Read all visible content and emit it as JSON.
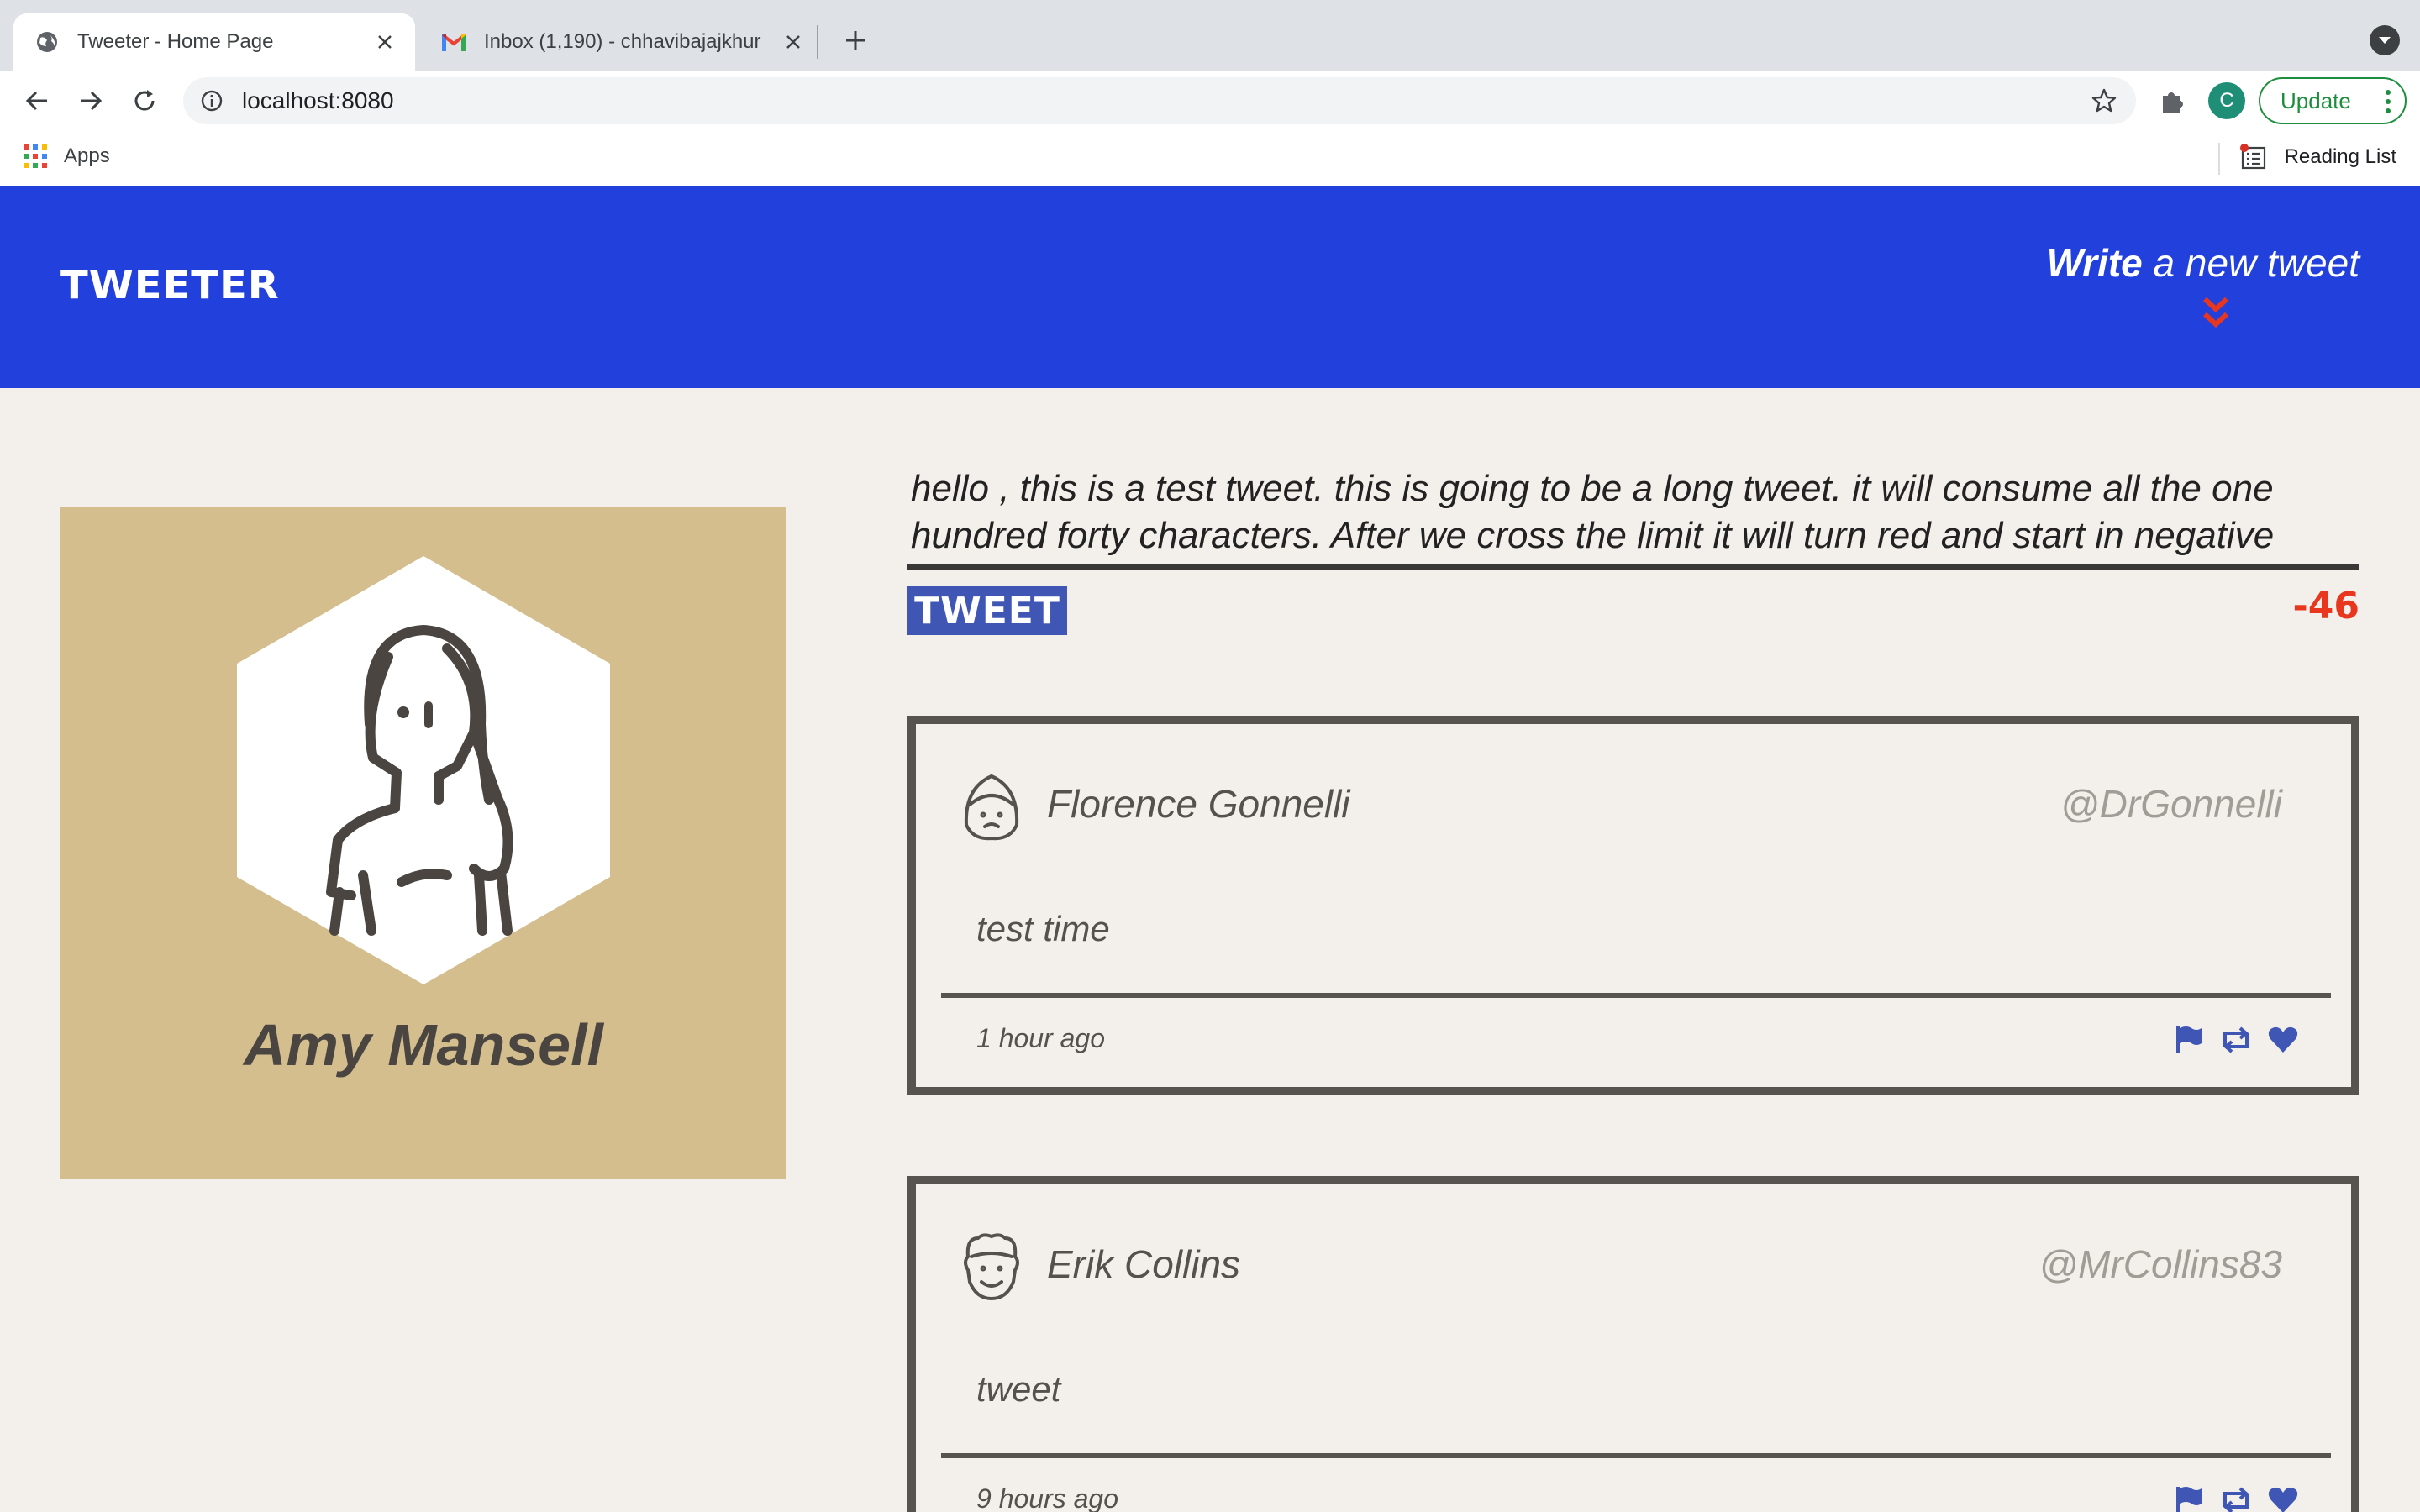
{
  "browser": {
    "tabs": [
      {
        "title": "Tweeter - Home Page",
        "active": true
      },
      {
        "title": "Inbox (1,190) - chhavibajajkhur",
        "active": false
      }
    ],
    "url": "localhost:8080",
    "profile_initial": "C",
    "update_label": "Update",
    "bookmarks": {
      "apps_label": "Apps",
      "reading_list_label": "Reading List"
    }
  },
  "header": {
    "logo": "TWEETER",
    "compose_bold": "Write",
    "compose_rest": " a new tweet"
  },
  "profile": {
    "name": "Amy Mansell"
  },
  "composer": {
    "draft_text": "hello , this is a test tweet. this is going to be a long tweet. it will consume all the one hundred forty characters. After we cross the limit it will turn red and start in negative",
    "submit_label": "TWEET",
    "counter": "-46"
  },
  "tweets": [
    {
      "author": "Florence Gonnelli",
      "handle": "@DrGonnelli",
      "body": "test time",
      "time": "1 hour ago"
    },
    {
      "author": "Erik Collins",
      "handle": "@MrCollins83",
      "body": "tweet",
      "time": "9 hours ago"
    }
  ],
  "colors": {
    "header_bg": "#2140dc",
    "page_bg": "#f3f0eb",
    "profile_bg": "#d4be8e",
    "accent_red": "#e8371e",
    "button_blue": "#3f56b5",
    "border_dark": "#57534e"
  }
}
